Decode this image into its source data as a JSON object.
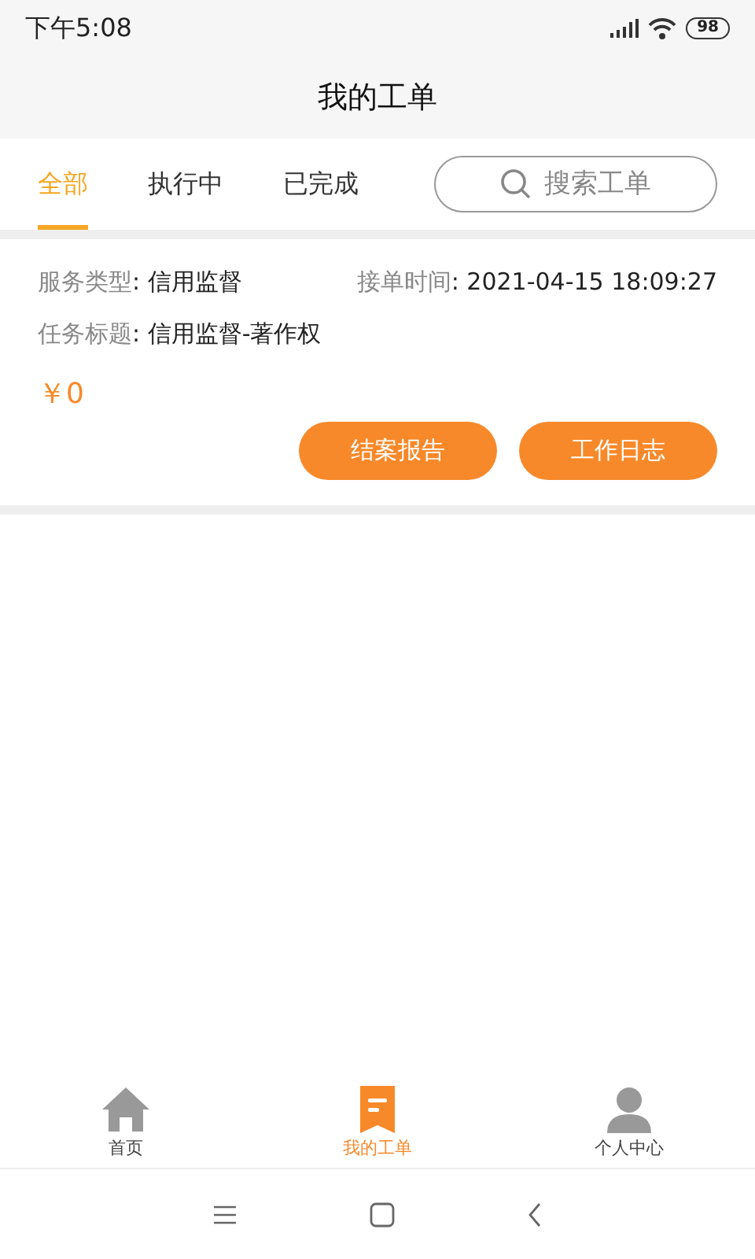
{
  "status_bar": {
    "time": "下午5:08",
    "battery": "98"
  },
  "header": {
    "title": "我的工单"
  },
  "tabs": [
    {
      "label": "全部",
      "selected": true
    },
    {
      "label": "执行中",
      "selected": false
    },
    {
      "label": "已完成",
      "selected": false
    }
  ],
  "search": {
    "placeholder": "搜索工单"
  },
  "orders": [
    {
      "fields": [
        {
          "label": "服务类型",
          "value": ": 信用监督"
        },
        {
          "label": "接单时间",
          "value": ": 2021-04-15 18:09:27"
        },
        {
          "label": "任务标题",
          "value": ": 信用监督-著作权"
        }
      ],
      "price": "￥0",
      "buttons": [
        "结案报告",
        "工作日志"
      ]
    }
  ],
  "bottom_nav": [
    {
      "kind": "home",
      "label": "首页",
      "selected": false
    },
    {
      "kind": "orders",
      "label": "我的工单",
      "selected": true
    },
    {
      "kind": "profile",
      "label": "个人中心",
      "selected": false
    }
  ]
}
